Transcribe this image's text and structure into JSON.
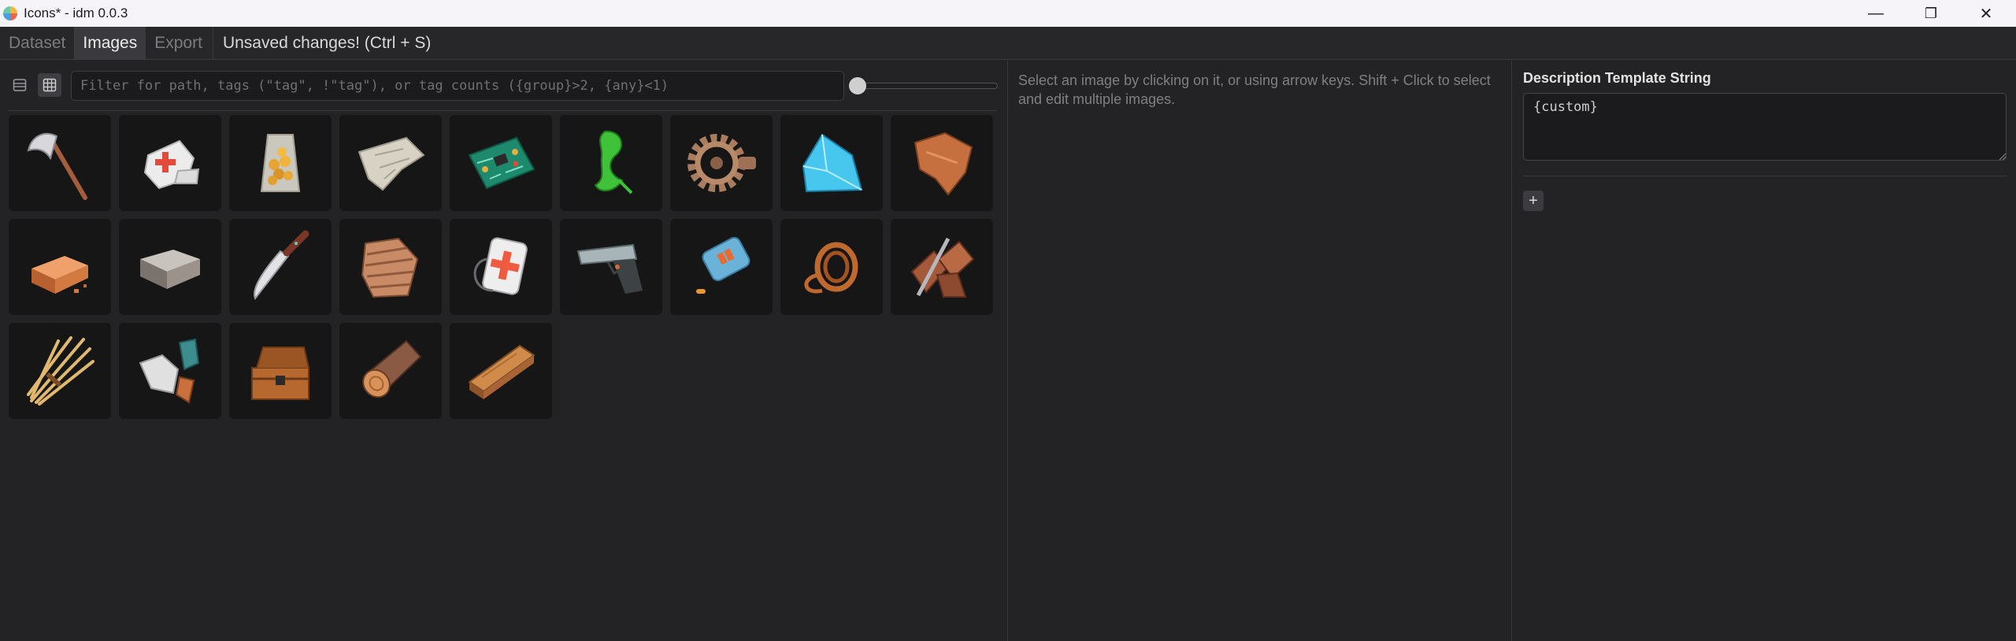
{
  "window": {
    "title": "Icons* - idm 0.0.3",
    "controls": {
      "minimize": "—",
      "maximize": "❐",
      "close": "✕"
    }
  },
  "menu": {
    "tabs": [
      "Dataset",
      "Images",
      "Export"
    ],
    "active_tab": "Images",
    "status": "Unsaved changes! (Ctrl + S)"
  },
  "gallery": {
    "filter_placeholder": "Filter for path, tags (\"tag\", !\"tag\"), or tag counts ({group}>2, {any}<1)",
    "filter_value": "",
    "view_mode": "grid",
    "thumbnail_size": 0.0,
    "images": [
      {
        "icon": "axe-icon"
      },
      {
        "icon": "bandage-icon"
      },
      {
        "icon": "chip-bag-icon"
      },
      {
        "icon": "cloth-icon"
      },
      {
        "icon": "circuit-board-icon"
      },
      {
        "icon": "green-slime-icon"
      },
      {
        "icon": "gear-icon"
      },
      {
        "icon": "crystal-icon"
      },
      {
        "icon": "leather-hide-icon"
      },
      {
        "icon": "copper-ingot-icon"
      },
      {
        "icon": "iron-ingot-icon"
      },
      {
        "icon": "knife-icon"
      },
      {
        "icon": "leather-stack-icon"
      },
      {
        "icon": "medkit-icon"
      },
      {
        "icon": "pistol-icon"
      },
      {
        "icon": "ammo-box-icon"
      },
      {
        "icon": "rope-icon"
      },
      {
        "icon": "scrap-pile-icon"
      },
      {
        "icon": "sticks-icon"
      },
      {
        "icon": "stone-icon"
      },
      {
        "icon": "wooden-chest-icon"
      },
      {
        "icon": "log-icon"
      },
      {
        "icon": "plank-icon"
      }
    ]
  },
  "info": {
    "hint": "Select an image by clicking on it, or using arrow keys. Shift + Click to select and edit multiple images."
  },
  "template": {
    "label": "Description Template String",
    "value": "{custom}",
    "add_label": "+"
  },
  "colors": {
    "titlebar_bg": "#f6f4f9",
    "app_bg": "#232325",
    "tile_bg": "#161617",
    "border": "#3a3a3e"
  }
}
